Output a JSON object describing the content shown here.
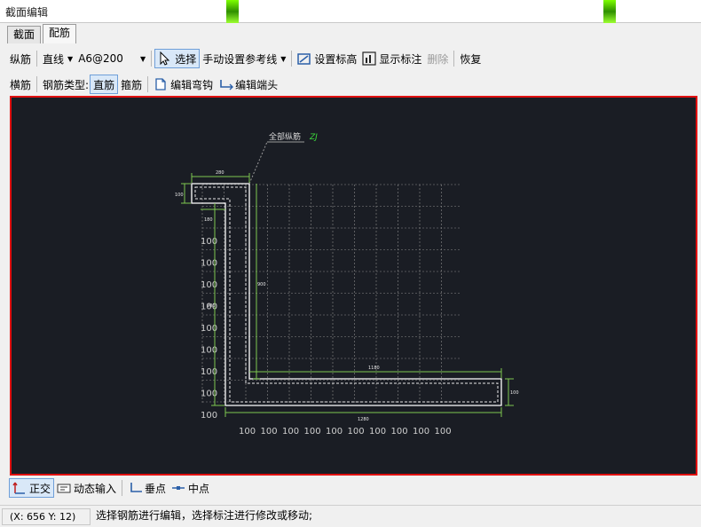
{
  "window": {
    "title": "截面编辑"
  },
  "tabs": [
    {
      "label": "截面"
    },
    {
      "label": "配筋"
    }
  ],
  "toolbar1": {
    "rebar_kind": "纵筋",
    "line_type": "直线",
    "spec_value": "A6@200",
    "select_label": "选择",
    "ref_line_label": "手动设置参考线",
    "set_elevation_label": "设置标高",
    "show_annotation_label": "显示标注",
    "delete_label": "删除",
    "restore_label": "恢复"
  },
  "toolbar2": {
    "horizontal_label": "横筋",
    "rebar_type_label": "钢筋类型:",
    "straight_label": "直筋",
    "stirrup_label": "箍筋",
    "edit_hook_label": "编辑弯钩",
    "edit_end_label": "编辑端头"
  },
  "canvas": {
    "leader_label": "全部纵筋",
    "leader_code": "ZJ",
    "dim_top": "280",
    "dim_left_top": "100",
    "dim_small": "180",
    "dim_inner_vertical": "900",
    "dim_outer_vertical": "900",
    "dim_inner_horizontal": "1180",
    "dim_right": "100",
    "dim_bottom": "1280",
    "grid_label": "100",
    "colors": {
      "background": "#1a1d24",
      "outline": "#ffffff",
      "dimension": "#7ec850",
      "grid": "#8a8a8a",
      "code": "#3cdc3c"
    }
  },
  "bottom_toolbar": {
    "ortho_label": "正交",
    "dynamic_input_label": "动态输入",
    "perpendicular_label": "垂点",
    "midpoint_label": "中点"
  },
  "status": {
    "coords": "(X: 656 Y: 12)",
    "message": "选择钢筋进行编辑，选择标注进行修改或移动;"
  }
}
